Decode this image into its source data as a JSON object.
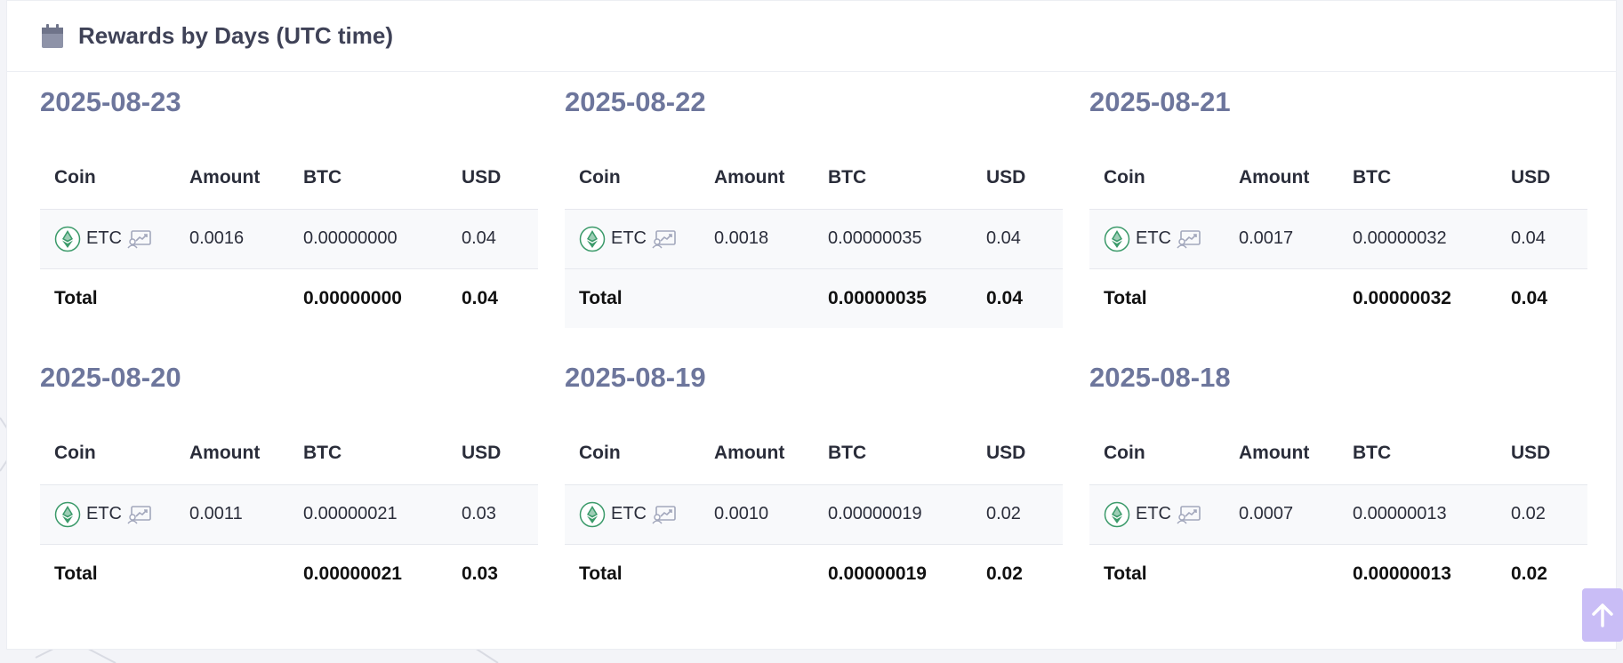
{
  "header": {
    "title": "Rewards by Days (UTC time)",
    "icon": "calendar-icon"
  },
  "columns": {
    "coin": "Coin",
    "amount": "Amount",
    "btc": "BTC",
    "usd": "USD"
  },
  "total_label": "Total",
  "days": [
    {
      "date": "2025-08-23",
      "coin": "ETC",
      "amount": "0.0016",
      "btc": "0.00000000",
      "usd": "0.04",
      "total_btc": "0.00000000",
      "total_usd": "0.04"
    },
    {
      "date": "2025-08-22",
      "coin": "ETC",
      "amount": "0.0018",
      "btc": "0.00000035",
      "usd": "0.04",
      "total_btc": "0.00000035",
      "total_usd": "0.04"
    },
    {
      "date": "2025-08-21",
      "coin": "ETC",
      "amount": "0.0017",
      "btc": "0.00000032",
      "usd": "0.04",
      "total_btc": "0.00000032",
      "total_usd": "0.04"
    },
    {
      "date": "2025-08-20",
      "coin": "ETC",
      "amount": "0.0011",
      "btc": "0.00000021",
      "usd": "0.03",
      "total_btc": "0.00000021",
      "total_usd": "0.03"
    },
    {
      "date": "2025-08-19",
      "coin": "ETC",
      "amount": "0.0010",
      "btc": "0.00000019",
      "usd": "0.02",
      "total_btc": "0.00000019",
      "total_usd": "0.02"
    },
    {
      "date": "2025-08-18",
      "coin": "ETC",
      "amount": "0.0007",
      "btc": "0.00000013",
      "usd": "0.02",
      "total_btc": "0.00000013",
      "total_usd": "0.02"
    }
  ],
  "icons": {
    "coin": "etc-coin-icon",
    "stats_link": "stats-link-icon",
    "scroll_top": "arrow-up-icon"
  },
  "colors": {
    "date": "#6d769c",
    "etc_green": "#3b9a6a",
    "scroll_button": "#c9bdf6"
  }
}
